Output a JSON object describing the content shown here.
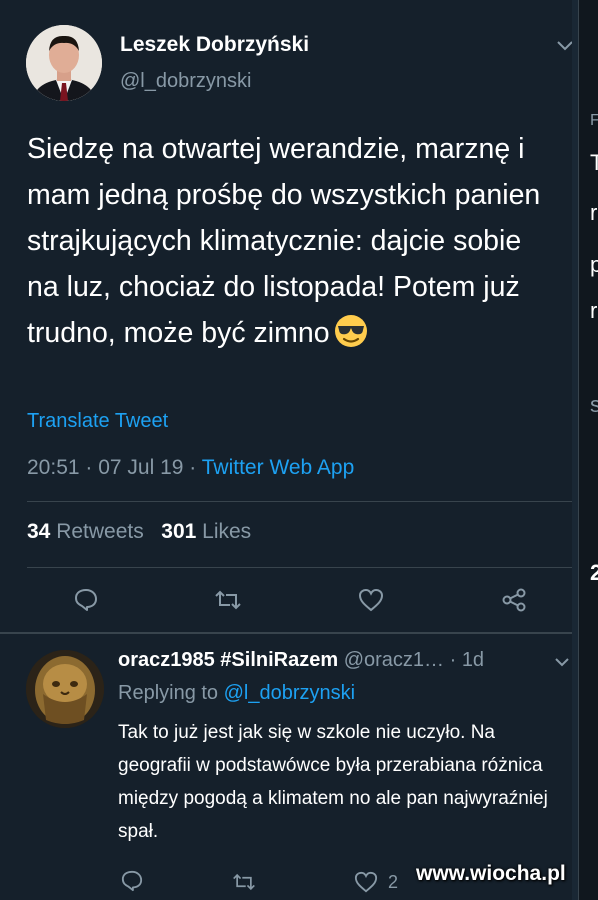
{
  "tweet": {
    "author_name": "Leszek Dobrzyński",
    "author_handle": "@l_dobrzynski",
    "text": "Siedzę na otwartej werandzie, marznę i mam jedną prośbę do wszystkich panien strajkujących klimatycznie: dajcie sobie na luz, chociaż do listopada! Potem już trudno, może być zimno",
    "emoji_name": "smiling-face-with-sunglasses",
    "translate_label": "Translate Tweet",
    "time": "20:51",
    "date": "07 Jul 19",
    "source": "Twitter Web App",
    "meta_sep": " · ",
    "retweets_count": "34",
    "retweets_label": "Retweets",
    "likes_count": "301",
    "likes_label": "Likes",
    "actions": [
      "reply-icon",
      "retweet-icon",
      "like-icon",
      "share-icon"
    ]
  },
  "reply": {
    "author_name": "oracz1985 #SilniRazem",
    "author_handle": "@oracz1…",
    "age": "1d",
    "replying_prefix": "Replying to ",
    "replying_to": "@l_dobrzynski",
    "text": "Tak to już jest jak się w szkole nie uczyło. Na geografii w podstawówce była przerabiana różnica między pogodą a klimatem no ale pan najwyraźniej spał.",
    "like_count": "2"
  },
  "side_letters": [
    "F",
    "T",
    "r",
    "p",
    "r",
    "s",
    "2"
  ],
  "watermark": "www.wiocha.pl",
  "colors": {
    "background": "#15202b",
    "accent": "#1da1f2",
    "secondary_text": "#8899a6",
    "divider": "#38444d"
  }
}
